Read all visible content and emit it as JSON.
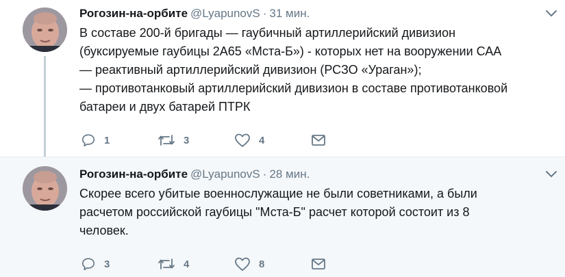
{
  "tweets": [
    {
      "author": {
        "name": "Рогозин-на-орбите",
        "handle": "@LyapunovS",
        "avatar_icon": "avatar-photo"
      },
      "separator": "·",
      "time": "31 мин.",
      "text_lines": [
        "В составе 200-й бригады — гаубичный артиллерийский дивизион",
        "(буксируемые гаубицы 2А65 «Мста-Б») - которых нет на вооружении САА",
        "— реактивный артиллерийский дивизион (РСЗО «Ураган»);",
        "— противотанковый артиллерийский дивизион в составе противотанковой",
        "батареи и двух батарей ПТРК"
      ],
      "actions": {
        "reply_count": "1",
        "retweet_count": "3",
        "like_count": "4"
      }
    },
    {
      "author": {
        "name": "Рогозин-на-орбите",
        "handle": "@LyapunovS",
        "avatar_icon": "avatar-photo"
      },
      "separator": "·",
      "time": "28 мин.",
      "text_lines": [
        "Скорее всего убитые военнослужащие не были советниками, а были",
        "расчетом российской гаубицы \"Мста-Б\" расчет которой состоит из 8",
        "человек."
      ],
      "actions": {
        "reply_count": "3",
        "retweet_count": "4",
        "like_count": "8"
      }
    }
  ],
  "icons": {
    "reply": "reply-icon",
    "retweet": "retweet-icon",
    "like": "heart-icon",
    "dm": "envelope-icon",
    "menu": "chevron-down-icon"
  },
  "colors": {
    "text": "#14171a",
    "secondary": "#657786",
    "thread_line": "#c4cfd6",
    "highlight_bg": "#f5f8fa"
  }
}
